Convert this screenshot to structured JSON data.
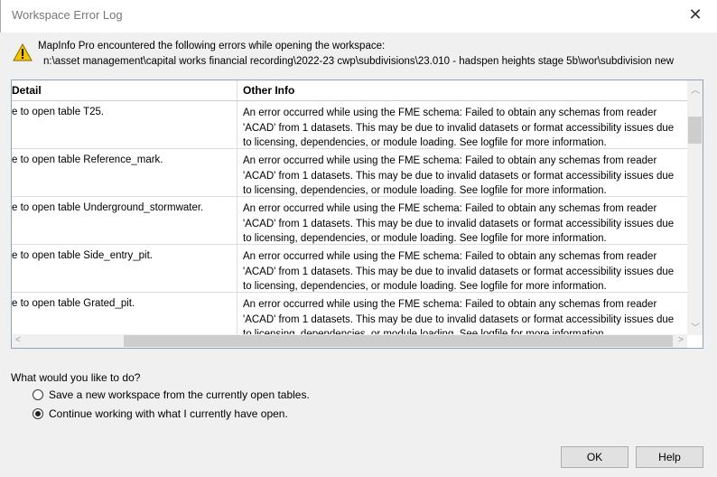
{
  "window": {
    "title": "Workspace Error Log",
    "close_icon": "close-icon"
  },
  "message": {
    "line1": "MapInfo Pro encountered the following errors while opening the workspace:",
    "line2": "n:\\asset management\\capital works financial recording\\2022-23 cwp\\subdivisions\\23.010 - hadspen heights stage 5b\\wor\\subdivision new",
    "icon": "warning-icon"
  },
  "table": {
    "columns": [
      "Detail",
      "Other Info"
    ],
    "rows": [
      {
        "detail": "e to open table T25.",
        "info": "An error occurred while using the FME schema: Failed to obtain any schemas from reader 'ACAD' from 1 datasets. This may be due to invalid datasets or format accessibility issues due to licensing, dependencies, or module loading. See logfile for more information."
      },
      {
        "detail": "e to open table Reference_mark.",
        "info": "An error occurred while using the FME schema: Failed to obtain any schemas from reader 'ACAD' from 1 datasets. This may be due to invalid datasets or format accessibility issues due to licensing, dependencies, or module loading. See logfile for more information."
      },
      {
        "detail": "e to open table Underground_stormwater.",
        "info": "An error occurred while using the FME schema: Failed to obtain any schemas from reader 'ACAD' from 1 datasets. This may be due to invalid datasets or format accessibility issues due to licensing, dependencies, or module loading. See logfile for more information."
      },
      {
        "detail": "e to open table Side_entry_pit.",
        "info": "An error occurred while using the FME schema: Failed to obtain any schemas from reader 'ACAD' from 1 datasets. This may be due to invalid datasets or format accessibility issues due to licensing, dependencies, or module loading. See logfile for more information."
      },
      {
        "detail": "e to open table Grated_pit.",
        "info": "An error occurred while using the FME schema: Failed to obtain any schemas from reader 'ACAD' from 1 datasets. This may be due to invalid datasets or format accessibility issues due to licensing, dependencies, or module loading. See logfile for more information."
      }
    ]
  },
  "question": "What would you like to do?",
  "options": [
    {
      "label": "Save a new workspace from the currently open tables.",
      "selected": false
    },
    {
      "label": "Continue working with what I currently have open.",
      "selected": true
    }
  ],
  "buttons": {
    "ok": "OK",
    "help": "Help"
  }
}
